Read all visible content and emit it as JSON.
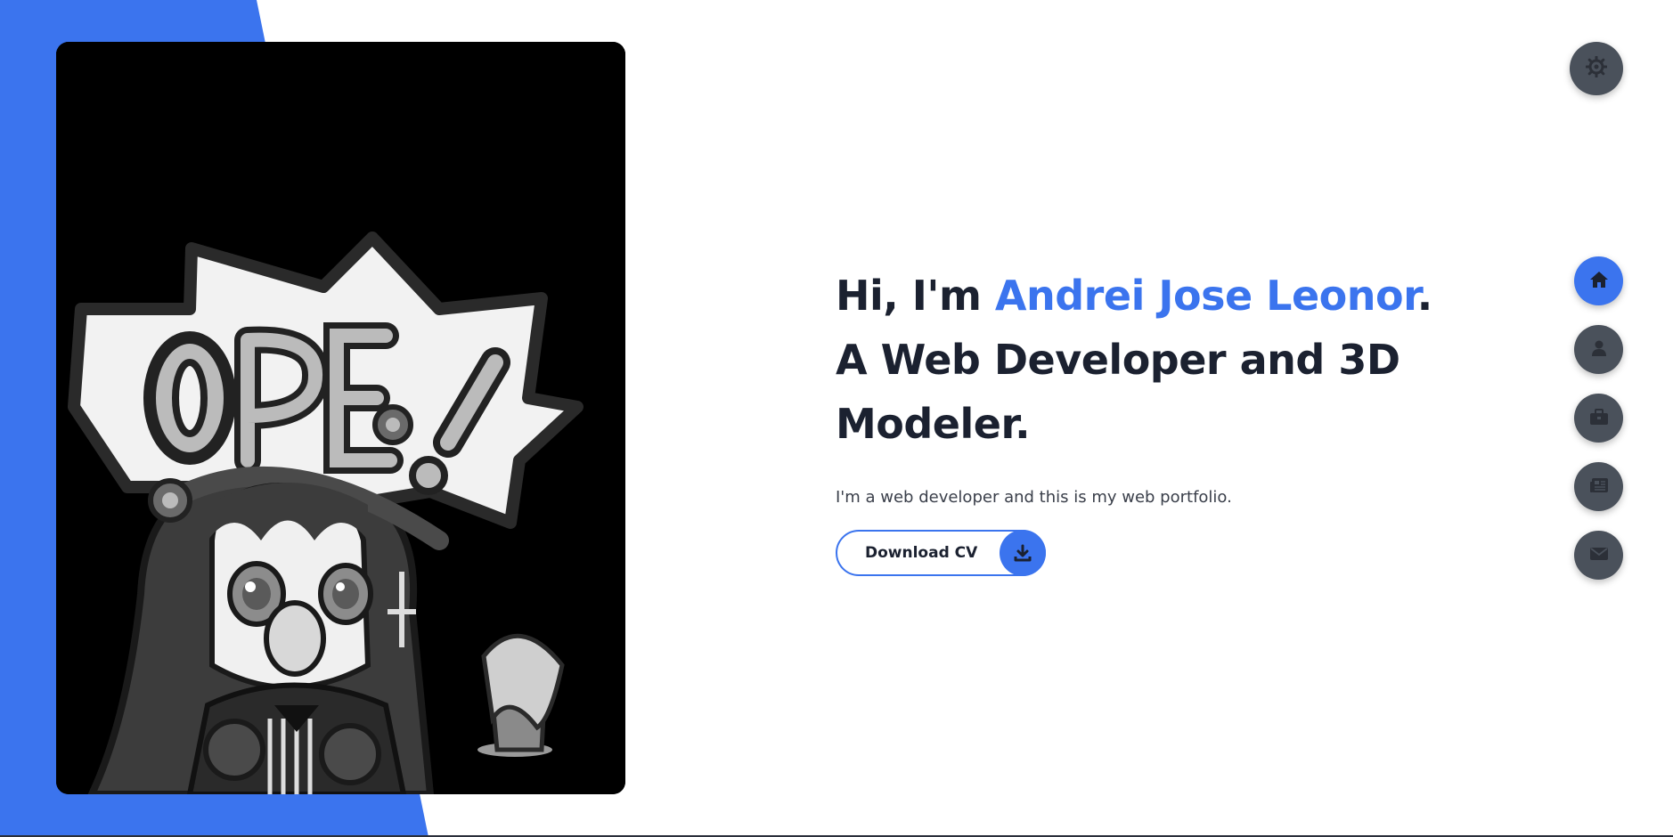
{
  "hero": {
    "greeting_prefix": "Hi, I'm ",
    "name": "Andrei Jose Leonor",
    "greeting_suffix": ".",
    "line2": "A Web Developer and 3D",
    "line3": "Modeler.",
    "subtitle": "I'm a web developer and this is my web portfolio.",
    "download_label": "Download CV"
  },
  "profile_image": {
    "caption": "OPE!",
    "style": "grayscale cartoon illustration"
  },
  "theme_toggle": {
    "icon": "gear-icon"
  },
  "nav": {
    "items": [
      {
        "icon": "home-icon",
        "active": true
      },
      {
        "icon": "user-icon",
        "active": false
      },
      {
        "icon": "briefcase-icon",
        "active": false
      },
      {
        "icon": "newspaper-icon",
        "active": false
      },
      {
        "icon": "envelope-icon",
        "active": false
      }
    ]
  },
  "colors": {
    "accent": "#3b74ee",
    "text": "#1b2130",
    "nav_inactive": "#4a515b",
    "background": "#ffffff"
  }
}
